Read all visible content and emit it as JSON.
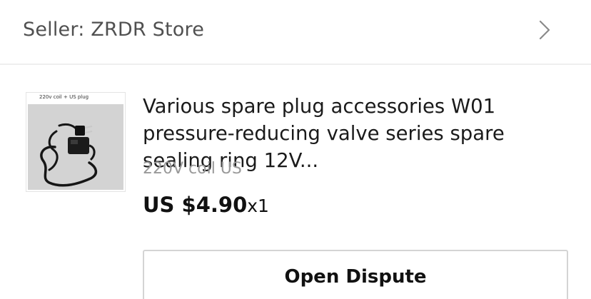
{
  "seller": {
    "label": "Seller: ZRDR Store",
    "chevron_icon": "chevron-right-icon"
  },
  "product": {
    "image_caption": "220v coil + US plug",
    "title": "Various spare plug accessories W01 pressure-reducing valve series spare sealing ring 12V...",
    "sku": "220V coil US",
    "price": "US $4.90",
    "quantity": "x1"
  },
  "actions": {
    "open_dispute_label": "Open Dispute"
  },
  "colors": {
    "seller_text": "#505050",
    "sku_text": "#999999",
    "divider": "#efefef",
    "button_border": "#d4d4d4"
  }
}
